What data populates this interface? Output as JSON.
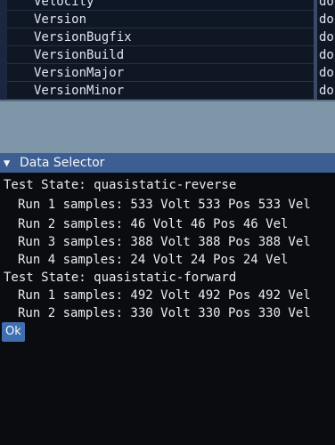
{
  "variables": [
    {
      "name": "Velocity",
      "type": "do"
    },
    {
      "name": "Version",
      "type": "do"
    },
    {
      "name": "VersionBugfix",
      "type": "do"
    },
    {
      "name": "VersionBuild",
      "type": "do"
    },
    {
      "name": "VersionMajor",
      "type": "do"
    },
    {
      "name": "VersionMinor",
      "type": "do"
    }
  ],
  "data_selector": {
    "title": "Data Selector",
    "collapse_icon": "triangle-down",
    "groups": [
      {
        "state_label": "Test State: quasistatic-reverse",
        "runs": [
          "Run 1 samples: 533 Volt 533 Pos 533 Vel",
          "Run 2 samples: 46 Volt 46 Pos 46 Vel",
          "Run 3 samples: 388 Volt 388 Pos 388 Vel",
          "Run 4 samples: 24 Volt 24 Pos 24 Vel"
        ]
      },
      {
        "state_label": "Test State: quasistatic-forward",
        "runs": [
          "Run 1 samples: 492 Volt 492 Pos 492 Vel",
          "Run 2 samples: 330 Volt 330 Pos 330 Vel"
        ]
      }
    ],
    "ok_label": "Ok"
  },
  "colors": {
    "titlebar": "#3d5e93",
    "ok_button": "#3f6fb0",
    "panel_band": "#7f96a8",
    "background": "#0b0c0f"
  }
}
